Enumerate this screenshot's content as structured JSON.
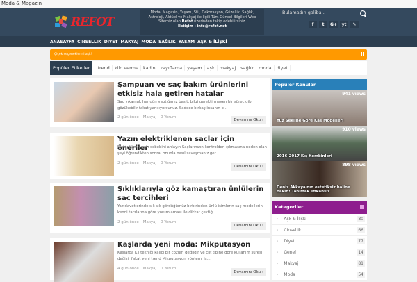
{
  "topbar": {
    "title": "Moda & Magazin"
  },
  "header": {
    "logo": "REFOT",
    "about": "Moda, Magazin, Yaşam, Stil, Dekorasyon, Güzellik, Sağlık, Astroloji, Aktüel ve Makyaj ile İlgili Tüm Güncel Bilgileri Web Sitemiz olan",
    "about_brand": "Refot",
    "about_tail": "üzerinden takip edebilirsiniz.",
    "contact": "İletişim : info@refot.net",
    "search_placeholder": "Bulamadın galiba..",
    "social": [
      "f",
      "t",
      "G+",
      "yt",
      "✎"
    ]
  },
  "nav": [
    "ANASAYFA",
    "CINSELLIK",
    "DIYET",
    "MAKYAJ",
    "MODA",
    "SAĞLIK",
    "YAŞAM",
    "AŞK & İLİŞKİ"
  ],
  "ticker": {
    "text": "Çiçek seçeneklerini aşk!"
  },
  "tags": {
    "label": "Popüler Etiketler",
    "items": [
      "trend",
      "kilo verme",
      "kadın",
      "zayıflama",
      "yaşam",
      "aşk",
      "makyaj",
      "sağlık",
      "moda",
      "diyet"
    ]
  },
  "posts": [
    {
      "title": "Şampuan ve saç bakım ürünlerini etkisiz hala getiren hatalar",
      "excerpt": "Saç yıkamak her gün yaptığımız basit, bilgi gerektirmeyen bir süreç gibi gözükebilir fakat yanılıyorsunuz. Sadece birkaç insanın b...",
      "date": "2 gün önce",
      "category": "Makyaj",
      "comments": "0 Yorum",
      "more": "Devamını Oku ›"
    },
    {
      "title": "Yazın elektriklenen saçlar için öneriler",
      "excerpt": "Elektriklenmenin sebebini anlayın Saçlarınızın kontrolden çıkmasına neden olan şeyi öğrendikten sonra, onunla nasıl savaşmanız ger...",
      "date": "2 gün önce",
      "category": "Makyaj",
      "comments": "0 Yorum",
      "more": "Devamını Oku ›"
    },
    {
      "title": "Şıklıklarıyla göz kamaştıran ünlülerin saç tercihleri",
      "excerpt": "Yaz davetlerinde sık sık gördüğümüz birbirinden ünlü isimlerin saç modellerini kendi tarzlarına göre yorumlaması ile dikkat çektiğ...",
      "date": "2 gün önce",
      "category": "Makyaj",
      "comments": "0 Yorum",
      "more": "Devamını Oku ›"
    },
    {
      "title": "Kaşlarda yeni moda: Mikputasyon",
      "excerpt": "Kaşlarda Kıl tekniği kalıcı bir çözüm değildir ve cilt tipine göre kullanım süresi değişir fakat yeni trend Mikputasyon yöntemi is...",
      "date": "4 gün önce",
      "category": "Makyaj",
      "comments": "0 Yorum",
      "more": "Devamını Oku ›"
    }
  ],
  "popular": {
    "title": "Popüler Konular",
    "items": [
      {
        "views": "941 views",
        "title": "Yüz Şekline Göre Kaş Modelleri"
      },
      {
        "views": "910 views",
        "title": "2016-2017 Kış Kombinleri"
      },
      {
        "views": "898 views",
        "title": "Deniz Akkaya'nın estetiksiz haline bakın! Tanımak imkansız"
      }
    ]
  },
  "categories": {
    "title": "Kategoriler",
    "items": [
      {
        "name": "Aşk & İlişki",
        "count": "80"
      },
      {
        "name": "Cinsellik",
        "count": "66"
      },
      {
        "name": "Diyet",
        "count": "77"
      },
      {
        "name": "Genel",
        "count": "14"
      },
      {
        "name": "Makyaj",
        "count": "81"
      },
      {
        "name": "Moda",
        "count": "54"
      }
    ]
  },
  "colors": {
    "header": "#34495e",
    "nav": "#2c3e50",
    "ticker": "#ff9900",
    "popular": "#2980b9",
    "categories": "#8e1e8e"
  }
}
